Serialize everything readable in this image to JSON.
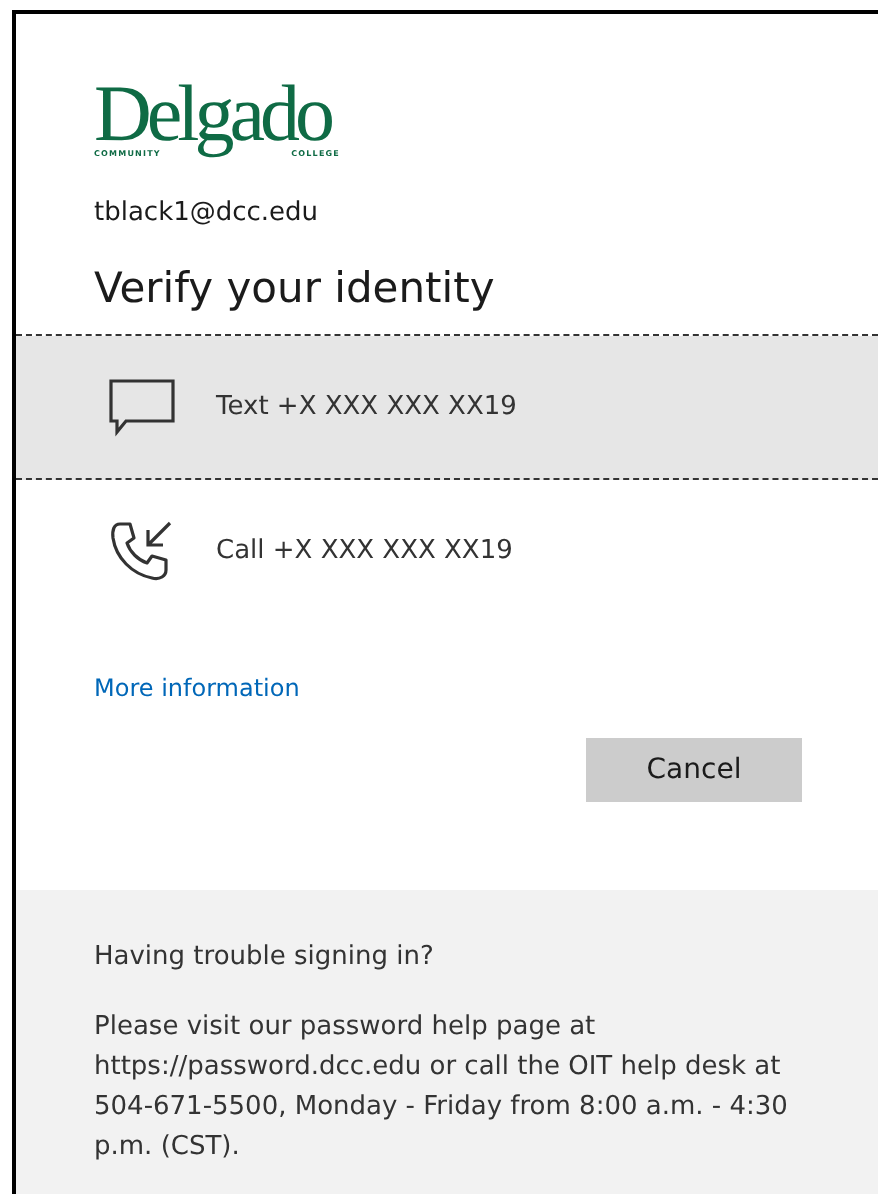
{
  "logo": {
    "name": "Delgado",
    "tagline_left": "COMMUNITY",
    "tagline_right": "COLLEGE"
  },
  "account": "tblack1@dcc.edu",
  "title": "Verify your identity",
  "options": [
    {
      "kind": "text",
      "label": "Text +X XXX XXX XX19",
      "selected": true
    },
    {
      "kind": "call",
      "label": "Call +X XXX XXX XX19",
      "selected": false
    }
  ],
  "more_link": "More information",
  "cancel_button": "Cancel",
  "footer": {
    "heading": "Having trouble signing in?",
    "body": "Please visit our password help page at https://password.dcc.edu or call the OIT help desk at 504-671-5500, Monday - Friday from 8:00 a.m. - 4:30 p.m. (CST)."
  }
}
